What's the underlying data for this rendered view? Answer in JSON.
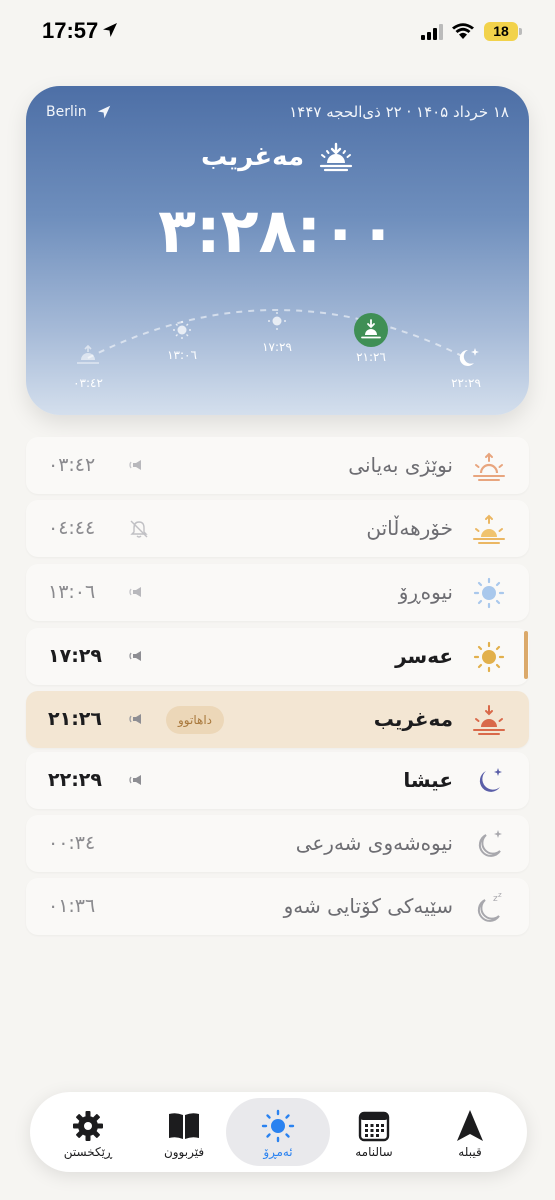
{
  "status_bar": {
    "time": "17:57",
    "battery": "18"
  },
  "hero": {
    "city": "Berlin",
    "dates": "۱۸ خرداد ۱۴۰۵ · ۲۲ ذی‌الحجه ۱۴۴۷",
    "prayer_name": "مەغریب",
    "countdown": "٣:٢٨:٠٠",
    "arc_times": [
      "٠٣:٤٢",
      "١٣:٠٦",
      "١٧:٢٩",
      "٢١:٢٦",
      "٢٢:٢٩"
    ]
  },
  "prayers": [
    {
      "name": "نوێژی بەیانی",
      "time": "٠٣:٤٢",
      "icon": "sunrise-icon",
      "sound": "speaker-icon"
    },
    {
      "name": "خۆرهەڵاتن",
      "time": "٠٤:٤٤",
      "icon": "sun-rising-icon",
      "sound": "bell-off-icon"
    },
    {
      "name": "نیوەڕۆ",
      "time": "١٣:٠٦",
      "icon": "sun-icon",
      "sound": "speaker-icon"
    },
    {
      "name": "عەسر",
      "time": "١٧:٢٩",
      "icon": "sun-icon",
      "sound": "speaker-icon"
    },
    {
      "name": "مەغریب",
      "time": "٢١:٢٦",
      "icon": "sunset-icon",
      "sound": "speaker-icon",
      "badge": "داهاتوو"
    },
    {
      "name": "عیشا",
      "time": "٢٢:٢٩",
      "icon": "moon-stars-icon",
      "sound": "speaker-icon"
    },
    {
      "name": "نیوەشەوی شەرعی",
      "time": "٠٠:٣٤",
      "icon": "moon-stars-icon"
    },
    {
      "name": "سێیەکی کۆتایی شەو",
      "time": "٠١:٣٦",
      "icon": "moon-zzz-icon"
    }
  ],
  "tabs": [
    {
      "label": "ڕێکخستن",
      "icon": "gear-icon"
    },
    {
      "label": "فێربوون",
      "icon": "book-icon"
    },
    {
      "label": "ئەمڕۆ",
      "icon": "sun-icon"
    },
    {
      "label": "سالنامە",
      "icon": "calendar-icon"
    },
    {
      "label": "قیبلە",
      "icon": "compass-arrow-icon"
    }
  ],
  "colors": {
    "accent": "#2a82f0",
    "active_row": "#f3e6d3",
    "current_marker": "#dba96a",
    "next_prayer_green": "#3f8f55",
    "sunset_orange": "#d9694a"
  }
}
